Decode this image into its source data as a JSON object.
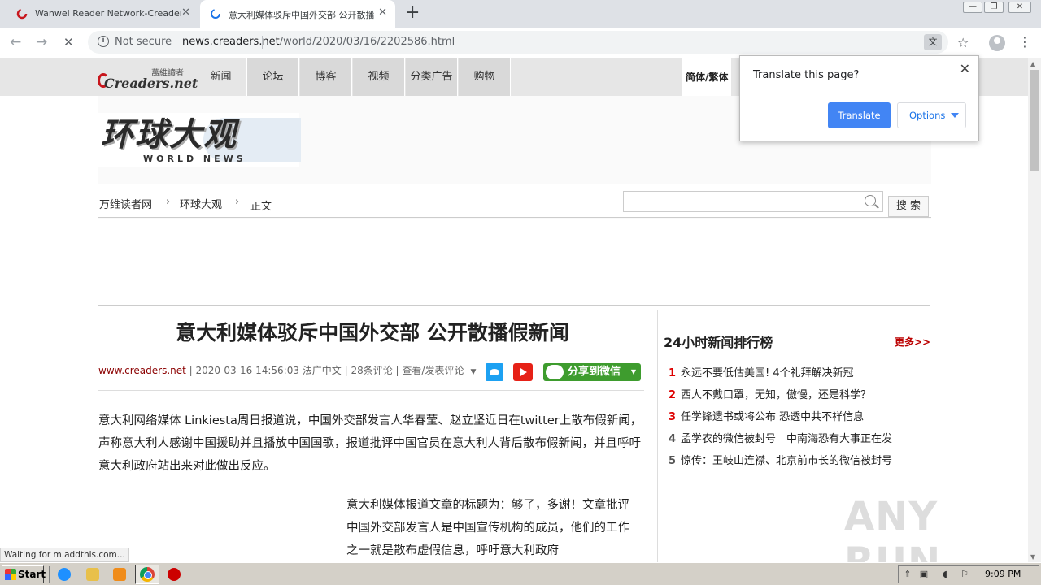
{
  "browser": {
    "tabs": [
      {
        "title": "Wanwei Reader Network-Creaders.N",
        "active": false
      },
      {
        "title": "意大利媒体驳斥中国外交部 公开散播",
        "active": true
      }
    ],
    "new_tab": "+",
    "window_controls": {
      "minimize": "—",
      "maximize": "❐",
      "close": "✕"
    },
    "nav": {
      "back": "←",
      "forward": "→",
      "reload": "✕"
    },
    "security_label": "Not secure",
    "url_host": "news.creaders.net",
    "url_path": "/world/2020/03/16/2202586.html",
    "kebab": "⋮"
  },
  "translate_popup": {
    "question": "Translate this page?",
    "translate_button": "Translate",
    "options_button": "Options",
    "close": "✕"
  },
  "site": {
    "logo_cn": "萬維讀者",
    "logo_en": "Creaders.net",
    "nav": [
      "新闻",
      "论坛",
      "博客",
      "视频",
      "分类广告",
      "购物"
    ],
    "lang_toggle": "简体/繁体",
    "section_logo_cn": "环球大观",
    "section_logo_en": "WORLD NEWS",
    "breadcrumb": [
      "万维读者网",
      "环球大观",
      "正文"
    ],
    "breadcrumb_sep": "›",
    "search_placeholder": "",
    "search_button": "搜 索"
  },
  "article": {
    "title": "意大利媒体驳斥中国外交部 公开散播假新闻",
    "source": "www.creaders.net",
    "meta_rest": " | 2020-03-16 14:56:03  法广中文 | 28条评论 | 查看/发表评论",
    "share_wechat": "分享到微信",
    "paragraph1": "意大利网络媒体 Linkiesta周日报道说，中国外交部发言人华春莹、赵立坚近日在twitter上散布假新闻，声称意大利人感谢中国援助并且播放中国国歌，报道批评中国官员在意大利人背后散布假新闻，并且呼吁意大利政府站出来对此做出反应。",
    "paragraph2": "意大利媒体报道文章的标题为：够了，多谢！文章批评中国外交部发言人是中国宣传机构的成员，他们的工作之一就是散布虚假信息，呼吁意大利政府"
  },
  "ranking": {
    "title": "24小时新闻排行榜",
    "more": "更多>>",
    "items": [
      {
        "rank": "1",
        "text": "永远不要低估美国! 4个礼拜解决新冠"
      },
      {
        "rank": "2",
        "text": "西人不戴口罩，无知，傲慢，还是科学？"
      },
      {
        "rank": "3",
        "text": "任学锋遗书或将公布 恐透中共不祥信息"
      },
      {
        "rank": "4",
        "text": "孟学农的微信被封号　中南海恐有大事正在发"
      },
      {
        "rank": "5",
        "text": "惊传：王岐山连襟、北京前市长的微信被封号"
      }
    ]
  },
  "status_text": "Waiting for m.addthis.com...",
  "watermark": "ANY RUN",
  "taskbar": {
    "start": "Start",
    "clock": "9:09 PM"
  }
}
